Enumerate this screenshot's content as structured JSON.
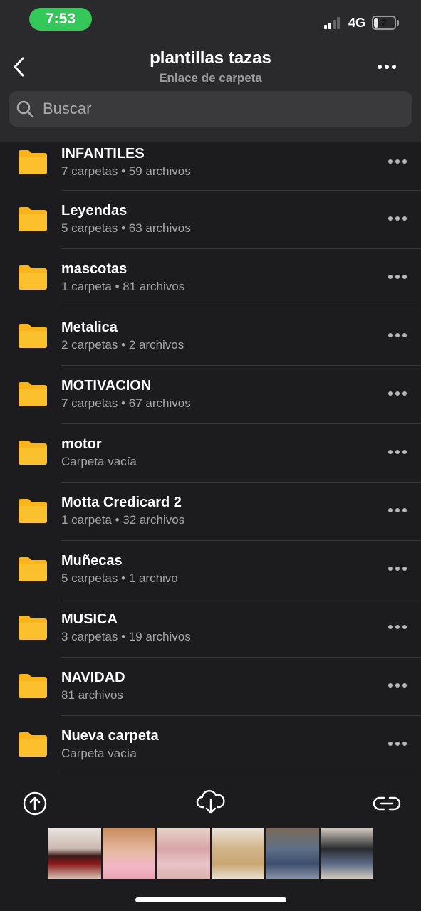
{
  "status_bar": {
    "time": "7:53",
    "network": "4G",
    "battery": "2",
    "battery_level": 0.2
  },
  "header": {
    "title": "plantillas tazas",
    "subtitle": "Enlace de carpeta",
    "back_icon": "chevron-left-icon",
    "more_icon": "ellipsis-icon"
  },
  "search": {
    "placeholder": "Buscar",
    "icon": "search-icon"
  },
  "folders": [
    {
      "name": "INFANTILES",
      "meta": "7 carpetas • 59 archivos"
    },
    {
      "name": "Leyendas",
      "meta": "5 carpetas • 63 archivos"
    },
    {
      "name": "mascotas",
      "meta": "1 carpeta • 81 archivos"
    },
    {
      "name": "Metalica",
      "meta": "2 carpetas • 2 archivos"
    },
    {
      "name": "MOTIVACION",
      "meta": "7 carpetas • 67 archivos"
    },
    {
      "name": "motor",
      "meta": "Carpeta vacía"
    },
    {
      "name": "Motta Credicard 2",
      "meta": "1 carpeta • 32 archivos"
    },
    {
      "name": "Muñecas",
      "meta": "5 carpetas • 1 archivo"
    },
    {
      "name": "MUSICA",
      "meta": "3 carpetas • 19 archivos"
    },
    {
      "name": "NAVIDAD",
      "meta": "81 archivos"
    },
    {
      "name": "Nueva carpeta",
      "meta": "Carpeta vacía"
    }
  ],
  "toolbar": {
    "upload_icon": "upload-icon",
    "download_icon": "cloud-download-icon",
    "link_icon": "link-icon"
  },
  "colors": {
    "folder": "#f9b51b",
    "accent_status": "#34c759",
    "background": "#1c1c1e",
    "header": "#2a2a2c"
  }
}
